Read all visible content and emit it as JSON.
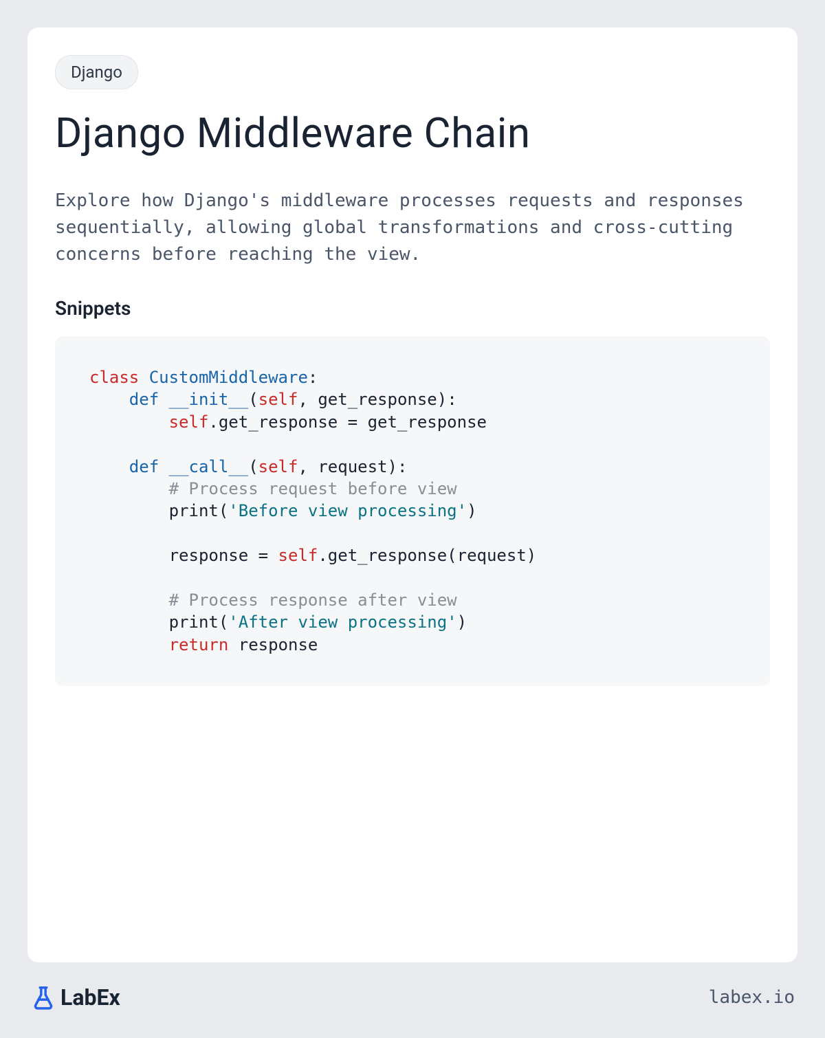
{
  "tag": "Django",
  "title": "Django Middleware Chain",
  "description": "Explore how Django's middleware processes requests and responses sequentially, allowing global transformations and cross-cutting concerns before reaching the view.",
  "snippets_label": "Snippets",
  "code": {
    "line1_class": "class",
    "line1_name": "CustomMiddleware",
    "line1_colon": ":",
    "line2_def": "def",
    "line2_name": "__init__",
    "line2_open": "(",
    "line2_self": "self",
    "line2_rest": ", get_response):",
    "line3_self": "self",
    "line3_rest": ".get_response = get_response",
    "line5_def": "def",
    "line5_name": "__call__",
    "line5_open": "(",
    "line5_self": "self",
    "line5_rest": ", request):",
    "line6_comment": "# Process request before view",
    "line7_print": "print(",
    "line7_str": "'Before view processing'",
    "line7_close": ")",
    "line9_resp": "response = ",
    "line9_self": "self",
    "line9_rest": ".get_response(request)",
    "line11_comment": "# Process response after view",
    "line12_print": "print(",
    "line12_str": "'After view processing'",
    "line12_close": ")",
    "line13_return": "return",
    "line13_rest": " response"
  },
  "brand_text": "LabEx",
  "site_url": "labex.io"
}
